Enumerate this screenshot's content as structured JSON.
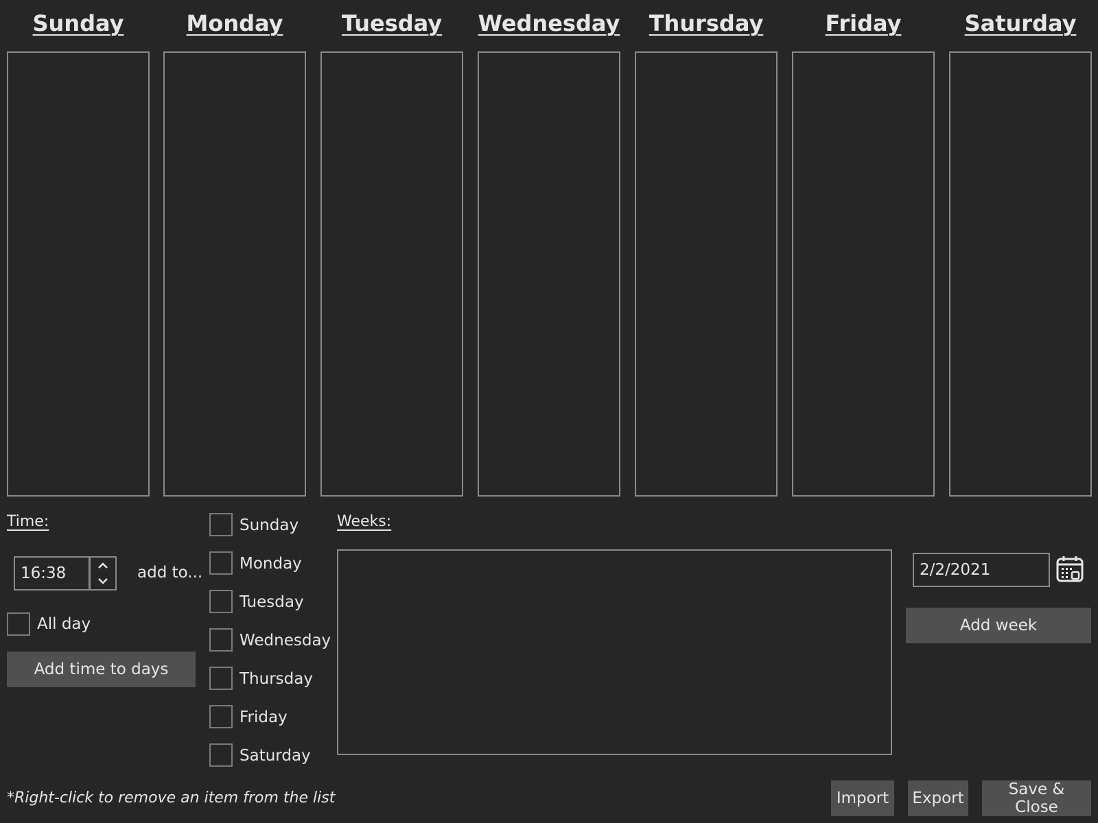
{
  "days": [
    "Sunday",
    "Monday",
    "Tuesday",
    "Wednesday",
    "Thursday",
    "Friday",
    "Saturday"
  ],
  "time": {
    "label": "Time:",
    "value": "16:38",
    "add_to_label": "add to...",
    "all_day_label": "All day",
    "add_button": "Add time to days"
  },
  "day_checkboxes": [
    "Sunday",
    "Monday",
    "Tuesday",
    "Wednesday",
    "Thursday",
    "Friday",
    "Saturday"
  ],
  "weeks": {
    "label": "Weeks:",
    "date_value": "2/2/2021",
    "add_button": "Add week"
  },
  "footer": {
    "hint": "*Right-click to remove an item from the list",
    "import_label": "Import",
    "export_label": "Export",
    "save_close_label": "Save & Close"
  },
  "icons": {
    "calendar": "calendar-icon",
    "spin_up": "chevron-up-icon",
    "spin_down": "chevron-down-icon"
  }
}
